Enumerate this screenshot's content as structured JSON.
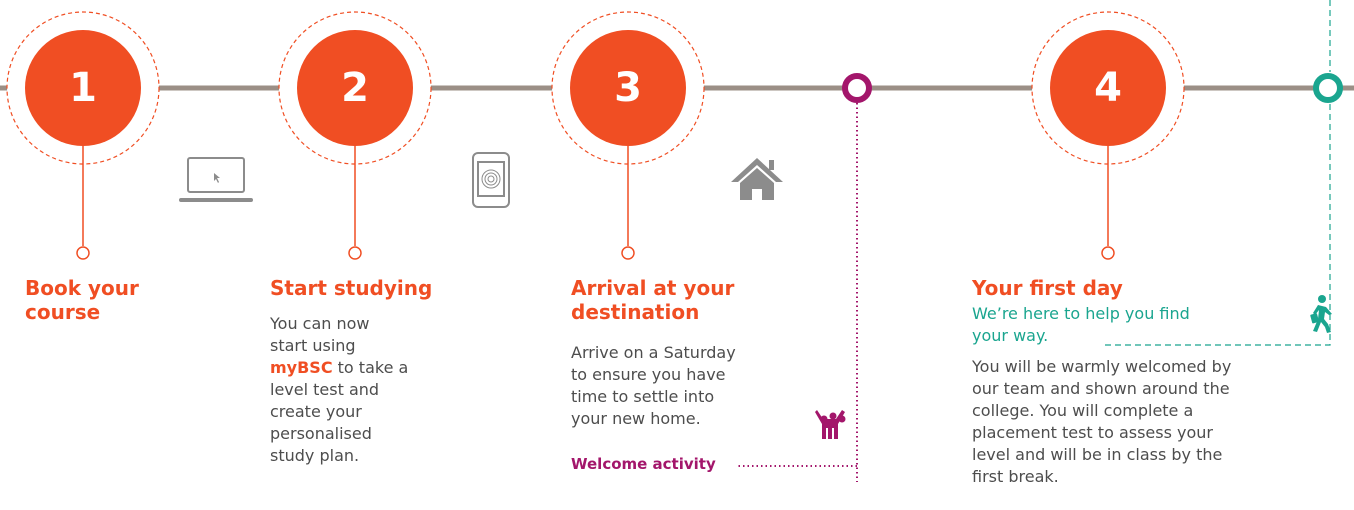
{
  "steps": [
    {
      "number": "1",
      "title": "Book your course"
    },
    {
      "number": "2",
      "title": "Start studying"
    },
    {
      "number": "3",
      "title": "Arrival at your destination"
    },
    {
      "number": "4",
      "title": "Your first day"
    }
  ],
  "step2_body": {
    "before": "You can now start using ",
    "highlight": "myBSC",
    "after": " to take a level test and create your personalised study plan."
  },
  "step3_body": "Arrive on a Saturday to ensure you have time to settle into your new home.",
  "welcome_activity": "Welcome activity",
  "step4_subtitle": "We’re here to help you find your way.",
  "step4_body": "You will be warmly welcomed by our team and shown around the college. You will complete a placement test to assess your level and will be in class by the first break.",
  "icons": [
    "laptop-icon",
    "tablet-fingerprint-icon",
    "house-icon",
    "people-group-icon",
    "walking-person-icon"
  ],
  "colors": {
    "accent": "#f04e23",
    "line": "#9b8f86",
    "magenta": "#a3166b",
    "teal": "#1aa58f",
    "icon_gray": "#8c8c8c"
  }
}
